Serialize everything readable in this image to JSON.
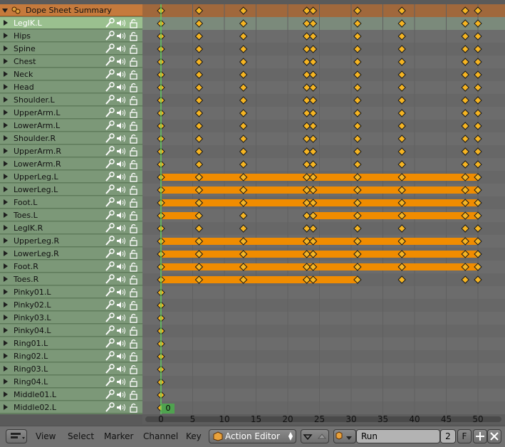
{
  "summary": {
    "label": "Dope Sheet Summary"
  },
  "channels": [
    {
      "label": "LegIK.L",
      "selected": true
    },
    {
      "label": "Hips"
    },
    {
      "label": "Spine"
    },
    {
      "label": "Chest"
    },
    {
      "label": "Neck"
    },
    {
      "label": "Head"
    },
    {
      "label": "Shoulder.L"
    },
    {
      "label": "UpperArm.L"
    },
    {
      "label": "LowerArm.L"
    },
    {
      "label": "Shoulder.R"
    },
    {
      "label": "UpperArm.R"
    },
    {
      "label": "LowerArm.R"
    },
    {
      "label": "UpperLeg.L"
    },
    {
      "label": "LowerLeg.L"
    },
    {
      "label": "Foot.L"
    },
    {
      "label": "Toes.L"
    },
    {
      "label": "LegIK.R"
    },
    {
      "label": "UpperLeg.R"
    },
    {
      "label": "LowerLeg.R"
    },
    {
      "label": "Foot.R"
    },
    {
      "label": "Toes.R"
    },
    {
      "label": "Pinky01.L"
    },
    {
      "label": "Pinky02.L"
    },
    {
      "label": "Pinky03.L"
    },
    {
      "label": "Pinky04.L"
    },
    {
      "label": "Ring01.L"
    },
    {
      "label": "Ring02.L"
    },
    {
      "label": "Ring03.L"
    },
    {
      "label": "Ring04.L"
    },
    {
      "label": "Middle01.L"
    },
    {
      "label": "Middle02.L"
    }
  ],
  "keyframes": {
    "full": [
      0,
      6,
      13,
      23,
      24,
      31,
      38,
      48,
      50
    ],
    "first_only": [
      0
    ],
    "hold_bars": {
      "UpperLeg.L": [
        [
          0,
          50
        ]
      ],
      "LowerLeg.L": [
        [
          0,
          50
        ]
      ],
      "Foot.L": [
        [
          0,
          50
        ]
      ],
      "Toes.L": [
        [
          0,
          6
        ],
        [
          24,
          50
        ]
      ],
      "UpperLeg.R": [
        [
          0,
          50
        ]
      ],
      "LowerLeg.R": [
        [
          0,
          50
        ]
      ],
      "Foot.R": [
        [
          0,
          50
        ]
      ],
      "Toes.R": [
        [
          0,
          31
        ]
      ]
    }
  },
  "ruler": {
    "ticks": [
      "0",
      "5",
      "10",
      "15",
      "20",
      "25",
      "30",
      "35",
      "40",
      "45",
      "50"
    ],
    "current_frame": "0"
  },
  "header": {
    "menus": [
      "View",
      "Select",
      "Marker",
      "Channel",
      "Key"
    ],
    "mode": "Action Editor",
    "action_name": "Run",
    "users": "2",
    "fake_user": "F"
  },
  "colors": {
    "summary_bg": "#c57a3c",
    "channel_bg": "#7c9878",
    "selected_channel_bg": "#9ac08f",
    "key_fill": "#f5b422",
    "hold_bar": "#f08c00",
    "current_frame_line": "#5fc95f"
  },
  "icons": [
    "summary-icon",
    "wrench-icon",
    "speaker-icon",
    "lock-icon",
    "editor-type-icon",
    "action-icon",
    "action-browse-icon",
    "new-action-icon",
    "unlink-icon"
  ]
}
